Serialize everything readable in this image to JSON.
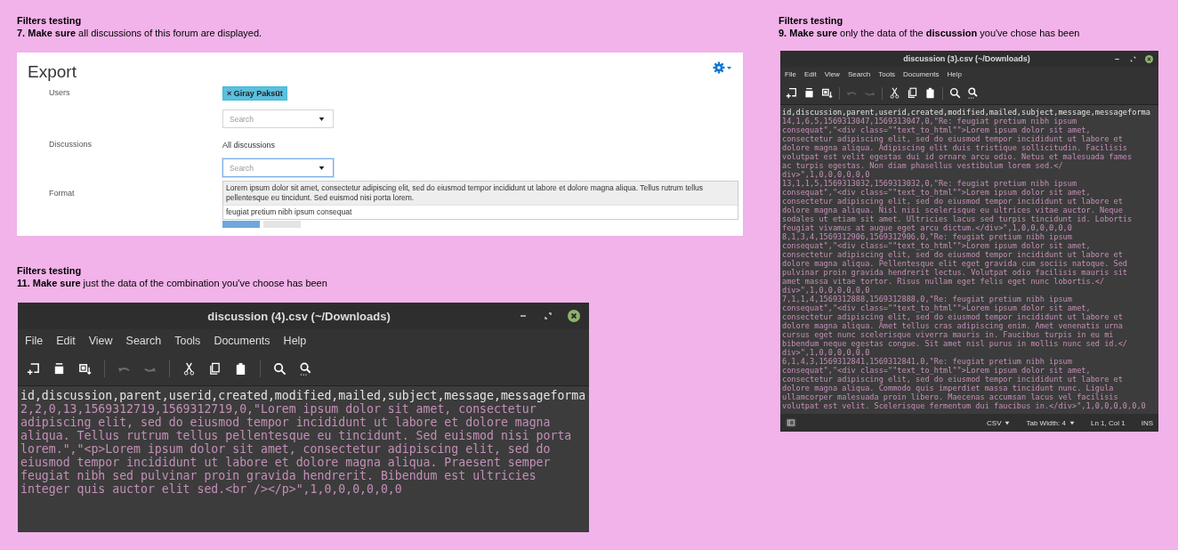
{
  "left_column": [
    {
      "kind": "form",
      "caption": {
        "title": "Filters testing",
        "text": "**7. Make sure** all discussions of this forum are displayed."
      },
      "heading": "Export",
      "rows": [
        {
          "label": "Users",
          "value": {
            "kind": "chip",
            "text": "× Giray Paksüt"
          },
          "select": {
            "placeholder": "Search",
            "focused": false
          }
        },
        {
          "label": "Discussions",
          "value": {
            "kind": "text",
            "text": "All discussions"
          },
          "select": {
            "placeholder": "Search",
            "focused": true,
            "options": [
              {
                "text": "Lorem ipsum dolor sit amet, consectetur adipiscing elit, sed do eiusmod tempor incididunt ut labore et dolore magna aliqua. Tellus rutrum tellus pellentesque eu tincidunt. Sed euismod nisi porta lorem.",
                "highlighted": true
              },
              {
                "text": "feugiat pretium nibh ipsum consequat",
                "highlighted": false
              }
            ]
          }
        },
        {
          "label": "Format"
        }
      ],
      "buttons": [
        {
          "kind": "primary"
        },
        {
          "kind": "secondary"
        }
      ]
    },
    {
      "kind": "editor",
      "caption": {
        "title": "Filters testing",
        "text": "**11. Make sure** just the data of the combination you've choose has been"
      },
      "title": "discussion (4).csv (~/Downloads)",
      "menu": [
        "File",
        "Edit",
        "View",
        "Search",
        "Tools",
        "Documents",
        "Help"
      ],
      "toolbar": [
        {
          "disabled": false
        },
        {
          "disabled": false
        },
        {
          "disabled": false
        },
        {
          "disabled": true
        },
        {
          "disabled": true
        },
        {
          "disabled": false
        },
        {
          "disabled": false
        },
        {
          "disabled": false
        },
        {
          "disabled": false
        },
        {
          "disabled": false
        }
      ],
      "header": "id,discussion,parent,userid,created,modified,mailed,subject,message,messageforma",
      "lines": [
        "2,2,0,13,1569312719,1569312719,0,\"Lorem ipsum dolor sit amet, consectetur",
        "adipiscing elit, sed do eiusmod tempor incididunt ut labore et dolore magna",
        "aliqua. Tellus rutrum tellus pellentesque eu tincidunt. Sed euismod nisi porta",
        "lorem.\",\"<p>Lorem ipsum dolor sit amet, consectetur adipiscing elit, sed do",
        "eiusmod tempor incididunt ut labore et dolore magna aliqua. Praesent semper",
        "feugiat nibh sed pulvinar proin gravida hendrerit. Bibendum est ultricies",
        "integer quis auctor elit sed.<br /></p>\",1,0,0,0,0,0,0"
      ]
    }
  ],
  "right_column": [
    {
      "kind": "editor",
      "caption": {
        "title": "Filters testing",
        "text": "**9. Make sure** only the data of the **discussion** you've chose has been"
      },
      "title": "discussion (3).csv (~/Downloads)",
      "menu": [
        "File",
        "Edit",
        "View",
        "Search",
        "Tools",
        "Documents",
        "Help"
      ],
      "toolbar": [
        {
          "disabled": false
        },
        {
          "disabled": false
        },
        {
          "disabled": false
        },
        {
          "disabled": true
        },
        {
          "disabled": true
        },
        {
          "disabled": false
        },
        {
          "disabled": false
        },
        {
          "disabled": false
        },
        {
          "disabled": false
        },
        {
          "disabled": false
        }
      ],
      "header": "id,discussion,parent,userid,created,modified,mailed,subject,message,messageforma",
      "lines": [
        "14,1,6,5,1569313047,1569313047,0,\"Re: feugiat pretium nibh ipsum",
        "consequat\",\"<div class=\"\"text_to_html\"\">Lorem ipsum dolor sit amet,",
        "consectetur adipiscing elit, sed do eiusmod tempor incididunt ut labore et",
        "dolore magna aliqua. Adipiscing elit duis tristique sollicitudin. Facilisis",
        "volutpat est velit egestas dui id ornare arcu odio. Netus et malesuada fames",
        "ac turpis egestas. Non diam phasellus vestibulum lorem sed.</",
        "div>\",1,0,0,0,0,0,0",
        "13,1,1,5,1569313032,1569313032,0,\"Re: feugiat pretium nibh ipsum",
        "consequat\",\"<div class=\"\"text_to_html\"\">Lorem ipsum dolor sit amet,",
        "consectetur adipiscing elit, sed do eiusmod tempor incididunt ut labore et",
        "dolore magna aliqua. Nisl nisi scelerisque eu ultrices vitae auctor. Neque",
        "sodales ut etiam sit amet. Ultricies lacus sed turpis tincidunt id. Lobortis",
        "feugiat vivamus at augue eget arcu dictum.</div>\",1,0,0,0,0,0,0",
        "8,1,3,4,1569312906,1569312906,0,\"Re: feugiat pretium nibh ipsum",
        "consequat\",\"<div class=\"\"text_to_html\"\">Lorem ipsum dolor sit amet,",
        "consectetur adipiscing elit, sed do eiusmod tempor incididunt ut labore et",
        "dolore magna aliqua. Pellentesque elit eget gravida cum sociis natoque. Sed",
        "pulvinar proin gravida hendrerit lectus. Volutpat odio facilisis mauris sit",
        "amet massa vitae tortor. Risus nullam eget felis eget nunc lobortis.</",
        "div>\",1,0,0,0,0,0,0",
        "7,1,1,4,1569312888,1569312888,0,\"Re: feugiat pretium nibh ipsum",
        "consequat\",\"<div class=\"\"text_to_html\"\">Lorem ipsum dolor sit amet,",
        "consectetur adipiscing elit, sed do eiusmod tempor incididunt ut labore et",
        "dolore magna aliqua. Amet tellus cras adipiscing enim. Amet venenatis urna",
        "cursus eget nunc scelerisque viverra mauris in. Faucibus turpis in eu mi",
        "bibendum neque egestas congue. Sit amet nisl purus in mollis nunc sed id.</",
        "div>\",1,0,0,0,0,0,0",
        "6,1,4,3,1569312841,1569312841,0,\"Re: feugiat pretium nibh ipsum",
        "consequat\",\"<div class=\"\"text_to_html\"\">Lorem ipsum dolor sit amet,",
        "consectetur adipiscing elit, sed do eiusmod tempor incididunt ut labore et",
        "dolore magna aliqua. Commodo quis imperdiet massa tincidunt nunc. Ligula",
        "ullamcorper malesuada proin libero. Maecenas accumsan lacus vel facilisis",
        "volutpat est velit. Scelerisque fermentum dui faucibus in.</div>\",1,0,0,0,0,0,0"
      ],
      "status_bar": [
        {
          "text": "CSV",
          "dropdown": true
        },
        {
          "text": "Tab Width: 4",
          "dropdown": true
        },
        {
          "text": "Ln 1, Col 1",
          "dropdown": false
        },
        {
          "text": "INS",
          "dropdown": false
        }
      ]
    }
  ]
}
